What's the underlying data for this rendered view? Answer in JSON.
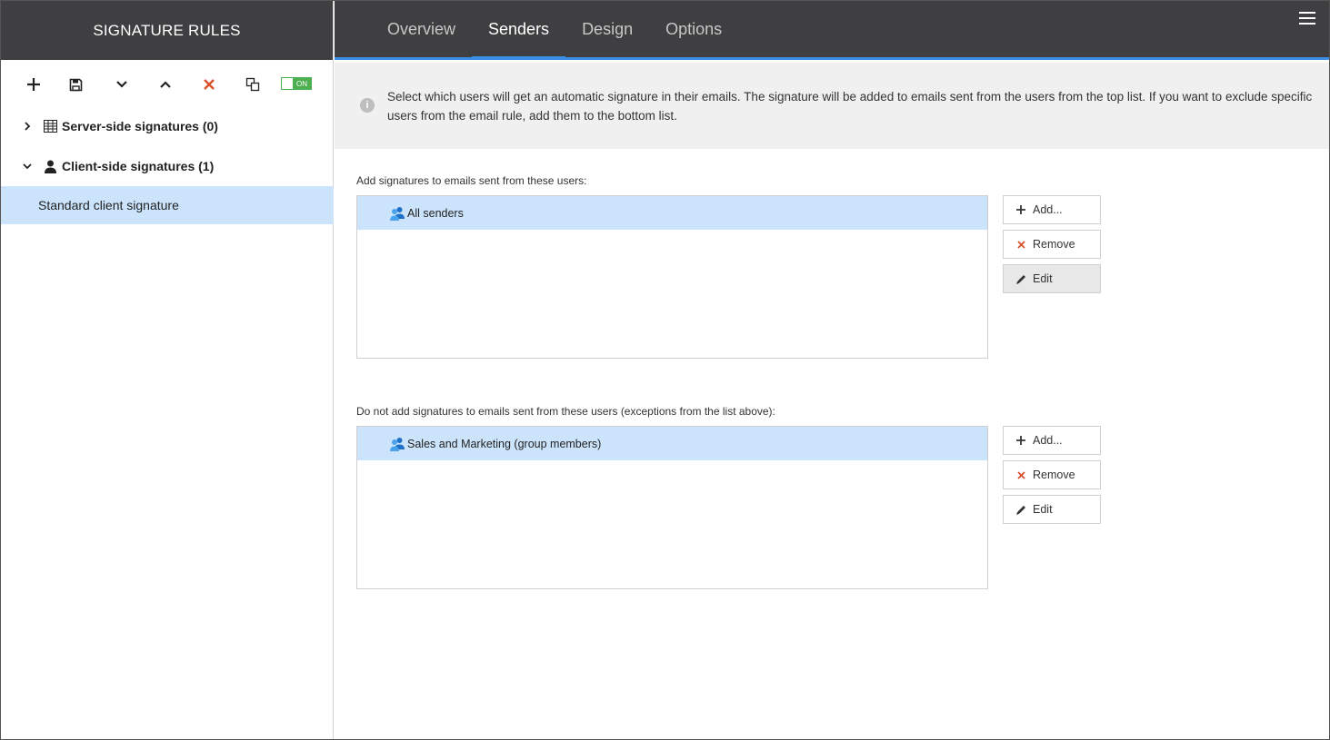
{
  "sidebar": {
    "title": "SIGNATURE RULES",
    "toolbar": {
      "toggle_label": "ON"
    },
    "tree": {
      "server_label": "Server-side signatures (0)",
      "client_label": "Client-side signatures (1)",
      "selected_item": "Standard client signature"
    }
  },
  "tabs": [
    "Overview",
    "Senders",
    "Design",
    "Options"
  ],
  "info": {
    "text": "Select which users will get an automatic signature in their emails. The signature will be added to emails sent from the users from the top list. If you want to exclude specific users from the email rule, add them to the bottom list."
  },
  "include": {
    "label": "Add signatures to emails sent from these users:",
    "items": [
      "All senders"
    ],
    "add": "Add...",
    "remove": "Remove",
    "edit": "Edit"
  },
  "exclude": {
    "label": "Do not add signatures to emails sent from these users (exceptions from the list above):",
    "items": [
      "Sales and Marketing (group members)"
    ],
    "add": "Add...",
    "remove": "Remove",
    "edit": "Edit"
  },
  "colors": {
    "accent": "#3a8ee6",
    "header_bg": "#3f3e40",
    "selection": "#cce4fb",
    "delete": "#d9502a",
    "toggle_on": "#4caf50"
  }
}
